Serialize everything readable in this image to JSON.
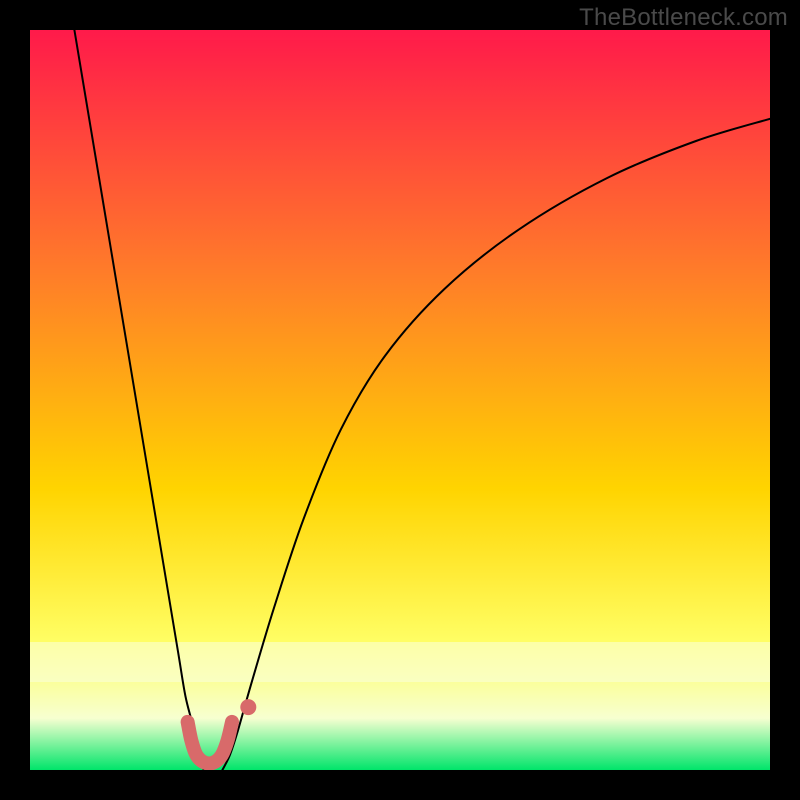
{
  "watermark": "TheBottleneck.com",
  "chart_data": {
    "type": "line",
    "title": "",
    "xlabel": "",
    "ylabel": "",
    "xlim": [
      0,
      100
    ],
    "ylim": [
      0,
      100
    ],
    "grid": false,
    "legend": false,
    "background_gradient": {
      "top": "#ff1a4a",
      "mid_upper": "#ff7a2a",
      "mid": "#ffd400",
      "mid_lower": "#ffff66",
      "band": "#f7ffd0",
      "bottom": "#00e56a"
    },
    "series": [
      {
        "name": "left-curve",
        "x": [
          6,
          8,
          10,
          12,
          14,
          16,
          18,
          20,
          21,
          22,
          22.5,
          23,
          23.5
        ],
        "y": [
          100,
          88,
          76,
          64,
          52,
          40,
          28,
          16,
          10,
          6,
          3,
          1,
          0
        ],
        "stroke": "#000000",
        "width": 2
      },
      {
        "name": "right-curve",
        "x": [
          26,
          27,
          28,
          30,
          33,
          37,
          42,
          48,
          56,
          66,
          78,
          90,
          100
        ],
        "y": [
          0,
          2,
          5,
          12,
          22,
          34,
          46,
          56,
          65,
          73,
          80,
          85,
          88
        ],
        "stroke": "#000000",
        "width": 2
      },
      {
        "name": "marker-stroke",
        "type": "path",
        "points": [
          [
            21.3,
            6.5
          ],
          [
            21.8,
            4.0
          ],
          [
            22.5,
            2.0
          ],
          [
            23.6,
            1.0
          ],
          [
            24.8,
            1.0
          ],
          [
            25.9,
            2.0
          ],
          [
            26.7,
            4.0
          ],
          [
            27.3,
            6.5
          ]
        ],
        "stroke": "#d86a6a",
        "width": 14,
        "linecap": "round"
      },
      {
        "name": "marker-dot",
        "type": "point",
        "x": 29.5,
        "y": 8.5,
        "r": 8,
        "fill": "#d86a6a"
      }
    ]
  }
}
